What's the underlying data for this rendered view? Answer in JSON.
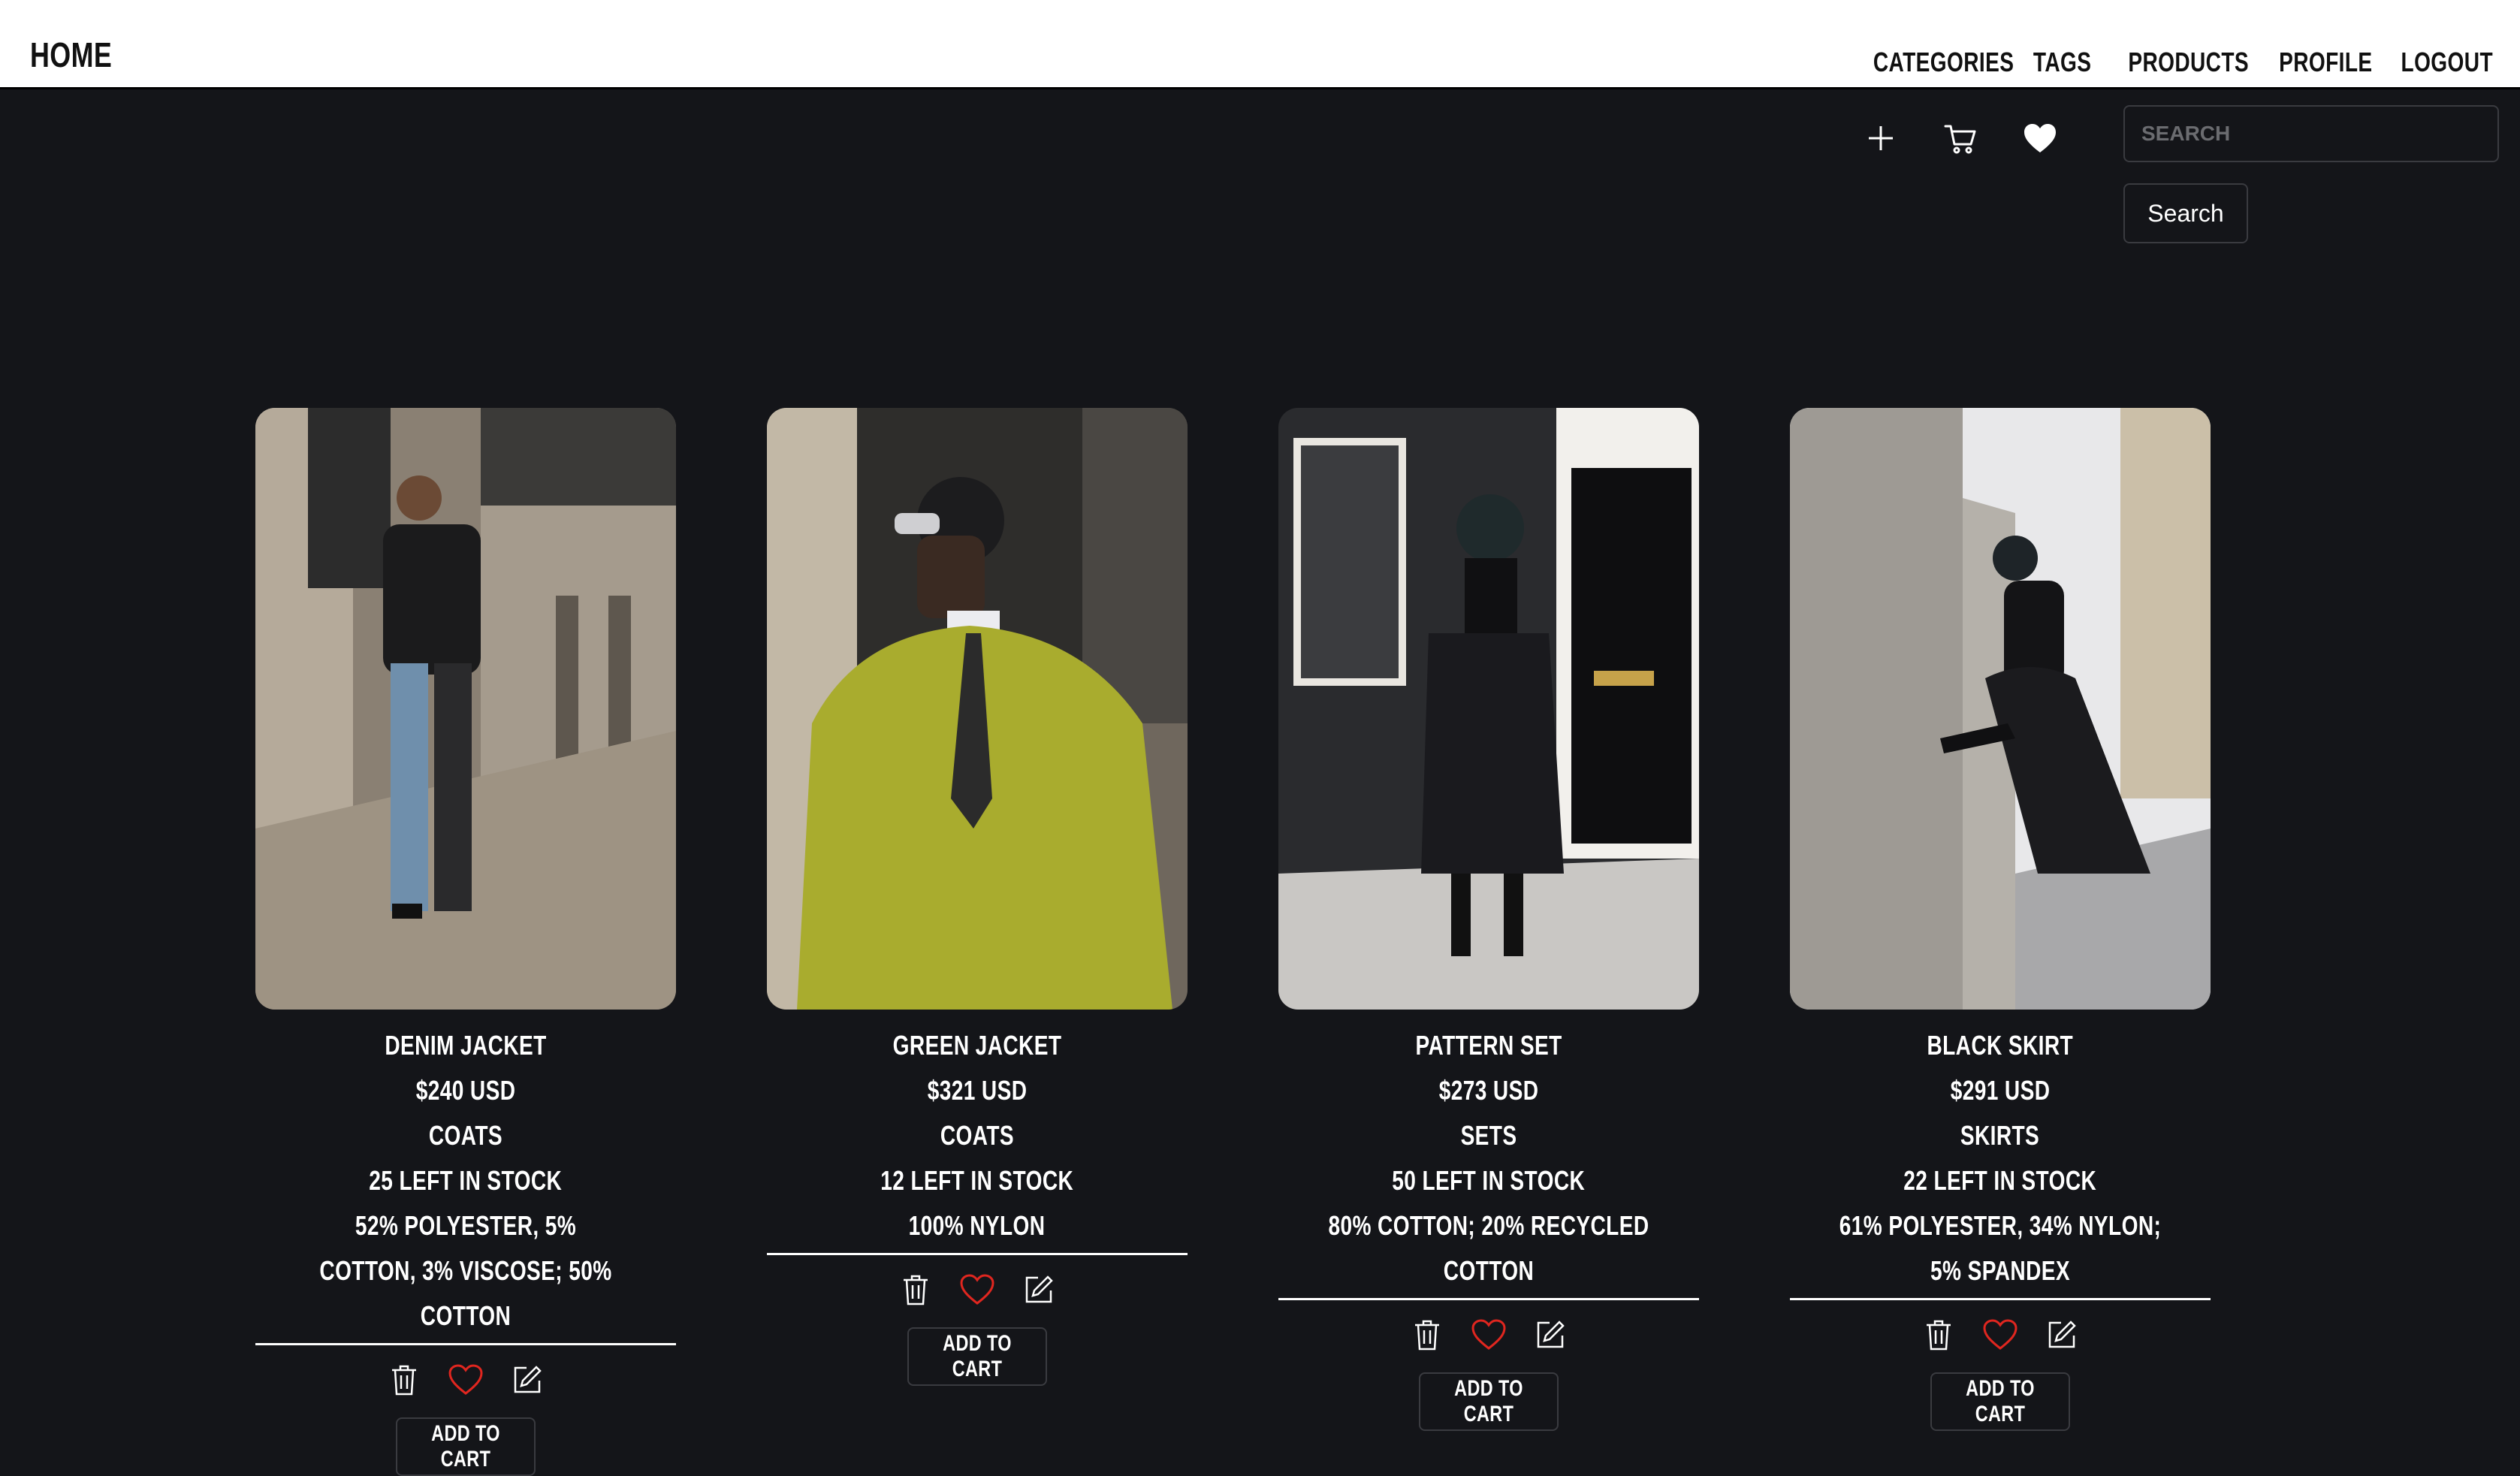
{
  "header": {
    "home_label": "HOME",
    "nav": [
      "CATEGORIES",
      "TAGS",
      "PRODUCTS",
      "PROFILE",
      "LOGOUT"
    ]
  },
  "toolbar": {
    "icons": [
      "plus-icon",
      "cart-icon",
      "heart-filled-icon"
    ]
  },
  "search": {
    "placeholder": "SEARCH",
    "value": "",
    "button_label": "Search"
  },
  "colors": {
    "background": "#141519",
    "topbar": "#ffffff",
    "heart_red": "#e0261f",
    "border": "#3a3b40"
  },
  "products": [
    {
      "name": "DENIM JACKET",
      "price": "$240 USD",
      "category": "COATS",
      "stock": "25 LEFT IN STOCK",
      "material": "52% POLYESTER, 5% COTTON, 3% VISCOSE; 50% COTTON",
      "cart_label": "ADD TO CART"
    },
    {
      "name": "GREEN JACKET",
      "price": "$321 USD",
      "category": "COATS",
      "stock": "12 LEFT IN STOCK",
      "material": "100% NYLON",
      "cart_label": "ADD TO CART"
    },
    {
      "name": "PATTERN SET",
      "price": "$273 USD",
      "category": "SETS",
      "stock": "50 LEFT IN STOCK",
      "material": "80% COTTON; 20% RECYCLED COTTON",
      "cart_label": "ADD TO CART"
    },
    {
      "name": "BLACK SKIRT",
      "price": "$291 USD",
      "category": "SKIRTS",
      "stock": "22 LEFT IN STOCK",
      "material": "61% POLYESTER, 34% NYLON; 5% SPANDEX",
      "cart_label": "ADD TO CART"
    }
  ]
}
